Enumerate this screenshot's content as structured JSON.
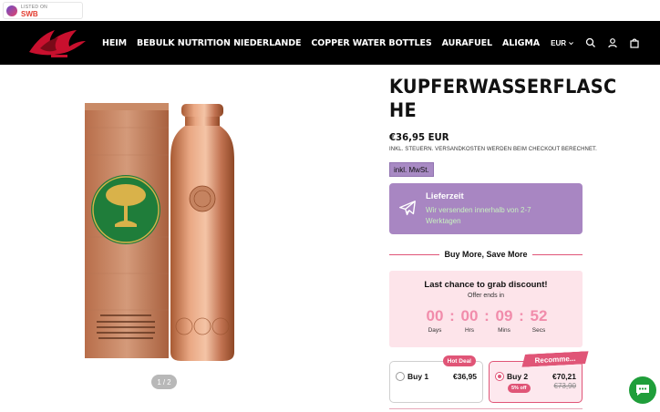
{
  "badge": {
    "listed_on": "LISTED ON",
    "brand": "SWB"
  },
  "nav": {
    "items": [
      "HEIM",
      "BEBULK NUTRITION NIEDERLANDE",
      "COPPER WATER BOTTLES",
      "AURAFUEL",
      "ALIGMA"
    ]
  },
  "header": {
    "currency": "EUR",
    "icons": [
      "search-icon",
      "account-icon",
      "cart-icon"
    ]
  },
  "gallery": {
    "current": "1",
    "separator": "/",
    "total": "2"
  },
  "product": {
    "title_line1": "KUPFERWASSERFLASC",
    "title_line2": "HE",
    "price": "€36,95 EUR",
    "tax_note": "INKL. STEUERN. VERSANDKOSTEN WERDEN BEIM CHECKOUT BERECHNET.",
    "vat_badge": "inkl. MwSt."
  },
  "delivery": {
    "title": "Lieferzeit",
    "text": "Wir versenden innerhalb von 2-7 Werktagen",
    "icon": "plane-icon"
  },
  "buy_more": {
    "heading": "Buy More, Save More"
  },
  "countdown": {
    "heading": "Last chance to grab discount!",
    "subheading": "Offer ends in",
    "days": "00",
    "hrs": "00",
    "mins": "09",
    "secs": "52",
    "days_label": "Days",
    "hrs_label": "Hrs",
    "mins_label": "Mins",
    "secs_label": "Secs"
  },
  "options": [
    {
      "label": "Buy 1",
      "price": "€36,95",
      "badge": "Hot Deal",
      "selected": false
    },
    {
      "label": "Buy 2",
      "price": "€70,21",
      "old_price": "€73,90",
      "discount": "5% off",
      "ribbon": "Recomme...",
      "selected": true
    }
  ],
  "colors": {
    "header_bg": "#000000",
    "accent_pink": "#e05577",
    "lilac": "#a886c2",
    "timer_pink": "#f18cab",
    "chat_green": "#1f9e3a",
    "copper": "#c8835a"
  }
}
